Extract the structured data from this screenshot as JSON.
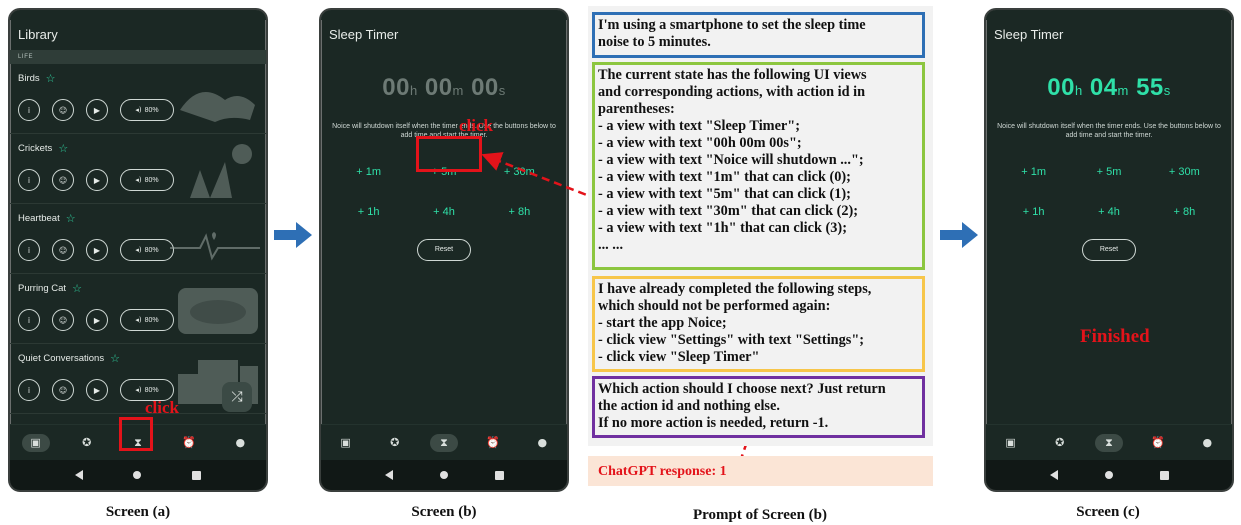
{
  "screen_a": {
    "title": "Library",
    "section": "LIFE",
    "sounds": [
      {
        "name": "Birds",
        "volume": "80%"
      },
      {
        "name": "Crickets",
        "volume": "80%"
      },
      {
        "name": "Heartbeat",
        "volume": "80%"
      },
      {
        "name": "Purring Cat",
        "volume": "80%"
      },
      {
        "name": "Quiet Conversations",
        "volume": "80%"
      }
    ],
    "click_label": "click",
    "caption": "Screen (a)"
  },
  "screen_b": {
    "title": "Sleep Timer",
    "timer": {
      "h": "00",
      "m": "00",
      "s": "00"
    },
    "note": "Noice will shutdown itself when the timer ends. Use the buttons below to add time and start the timer.",
    "buttons": [
      "+ 1m",
      "+ 5m",
      "+ 30m",
      "+ 1h",
      "+ 4h",
      "+ 8h"
    ],
    "reset": "Reset",
    "click_label": "click",
    "caption": "Screen (b)"
  },
  "screen_c": {
    "title": "Sleep Timer",
    "timer": {
      "h": "00",
      "m": "04",
      "s": "55"
    },
    "note": "Noice will shutdown itself when the timer ends. Use the buttons below to add time and start the timer.",
    "buttons": [
      "+ 1m",
      "+ 5m",
      "+ 30m",
      "+ 1h",
      "+ 4h",
      "+ 8h"
    ],
    "reset": "Reset",
    "finished": "Finished",
    "caption": "Screen (c)"
  },
  "prompt": {
    "task": [
      "I'm using a smartphone to set the sleep time",
      "noise to 5 minutes."
    ],
    "state": [
      "The current state has the following UI views",
      "and corresponding actions, with action id in",
      "parentheses:",
      " - a view with text \"Sleep Timer\";",
      " - a view with text \"00h 00m 00s\";",
      " - a view with text \"Noice will shutdown ...\";",
      " - a view with text \"1m\" that can click (0);",
      " - a view with text \"5m\" that can click (1);",
      " - a view with text \"30m\" that can click (2);",
      " - a view with text \"1h\" that can click (3);",
      "   ... ..."
    ],
    "history": [
      "I have already completed the following steps,",
      "which should not be performed again:",
      " - start the app Noice;",
      " - click view \"Settings\" with text \"Settings\";",
      " - click view \"Sleep Timer\""
    ],
    "question": [
      "Which action should I choose next? Just return",
      "the action id and nothing else.",
      "If no more action is needed, return -1."
    ],
    "response": "ChatGPT response: 1",
    "caption": "Prompt of Screen (b)"
  },
  "colors": {
    "accent": "#2fe0a8",
    "highlight": "#e3131a",
    "task_border": "#2e6fb5",
    "state_border": "#8cc63f",
    "history_border": "#f7c64a",
    "question_border": "#7030a0"
  }
}
